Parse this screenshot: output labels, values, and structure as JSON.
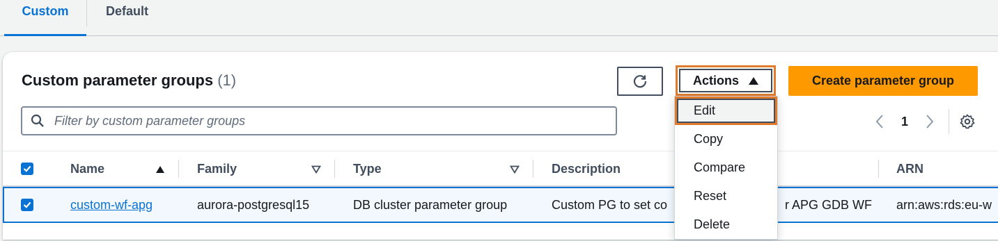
{
  "tabs": [
    {
      "label": "Custom",
      "active": true
    },
    {
      "label": "Default",
      "active": false
    }
  ],
  "header": {
    "title": "Custom parameter groups",
    "count": "(1)",
    "actions_label": "Actions",
    "create_label": "Create parameter group"
  },
  "filter": {
    "placeholder": "Filter by custom parameter groups",
    "value": ""
  },
  "pagination": {
    "current_page": "1"
  },
  "table": {
    "columns": [
      "Name",
      "Family",
      "Type",
      "Description",
      "ARN"
    ],
    "rows": [
      {
        "selected": true,
        "name": "custom-wf-apg",
        "family": "aurora-postgresql15",
        "type": "DB cluster parameter group",
        "description_left": "Custom PG to set co",
        "description_right": "r APG GDB WF",
        "arn": "arn:aws:rds:eu-w"
      }
    ]
  },
  "actions_menu": {
    "items": [
      "Edit",
      "Copy",
      "Compare",
      "Reset",
      "Delete"
    ],
    "highlighted": "Edit"
  },
  "colors": {
    "accent": "#0972d3",
    "primary_button": "#ff9900",
    "highlight_outline": "#e07b2e"
  }
}
